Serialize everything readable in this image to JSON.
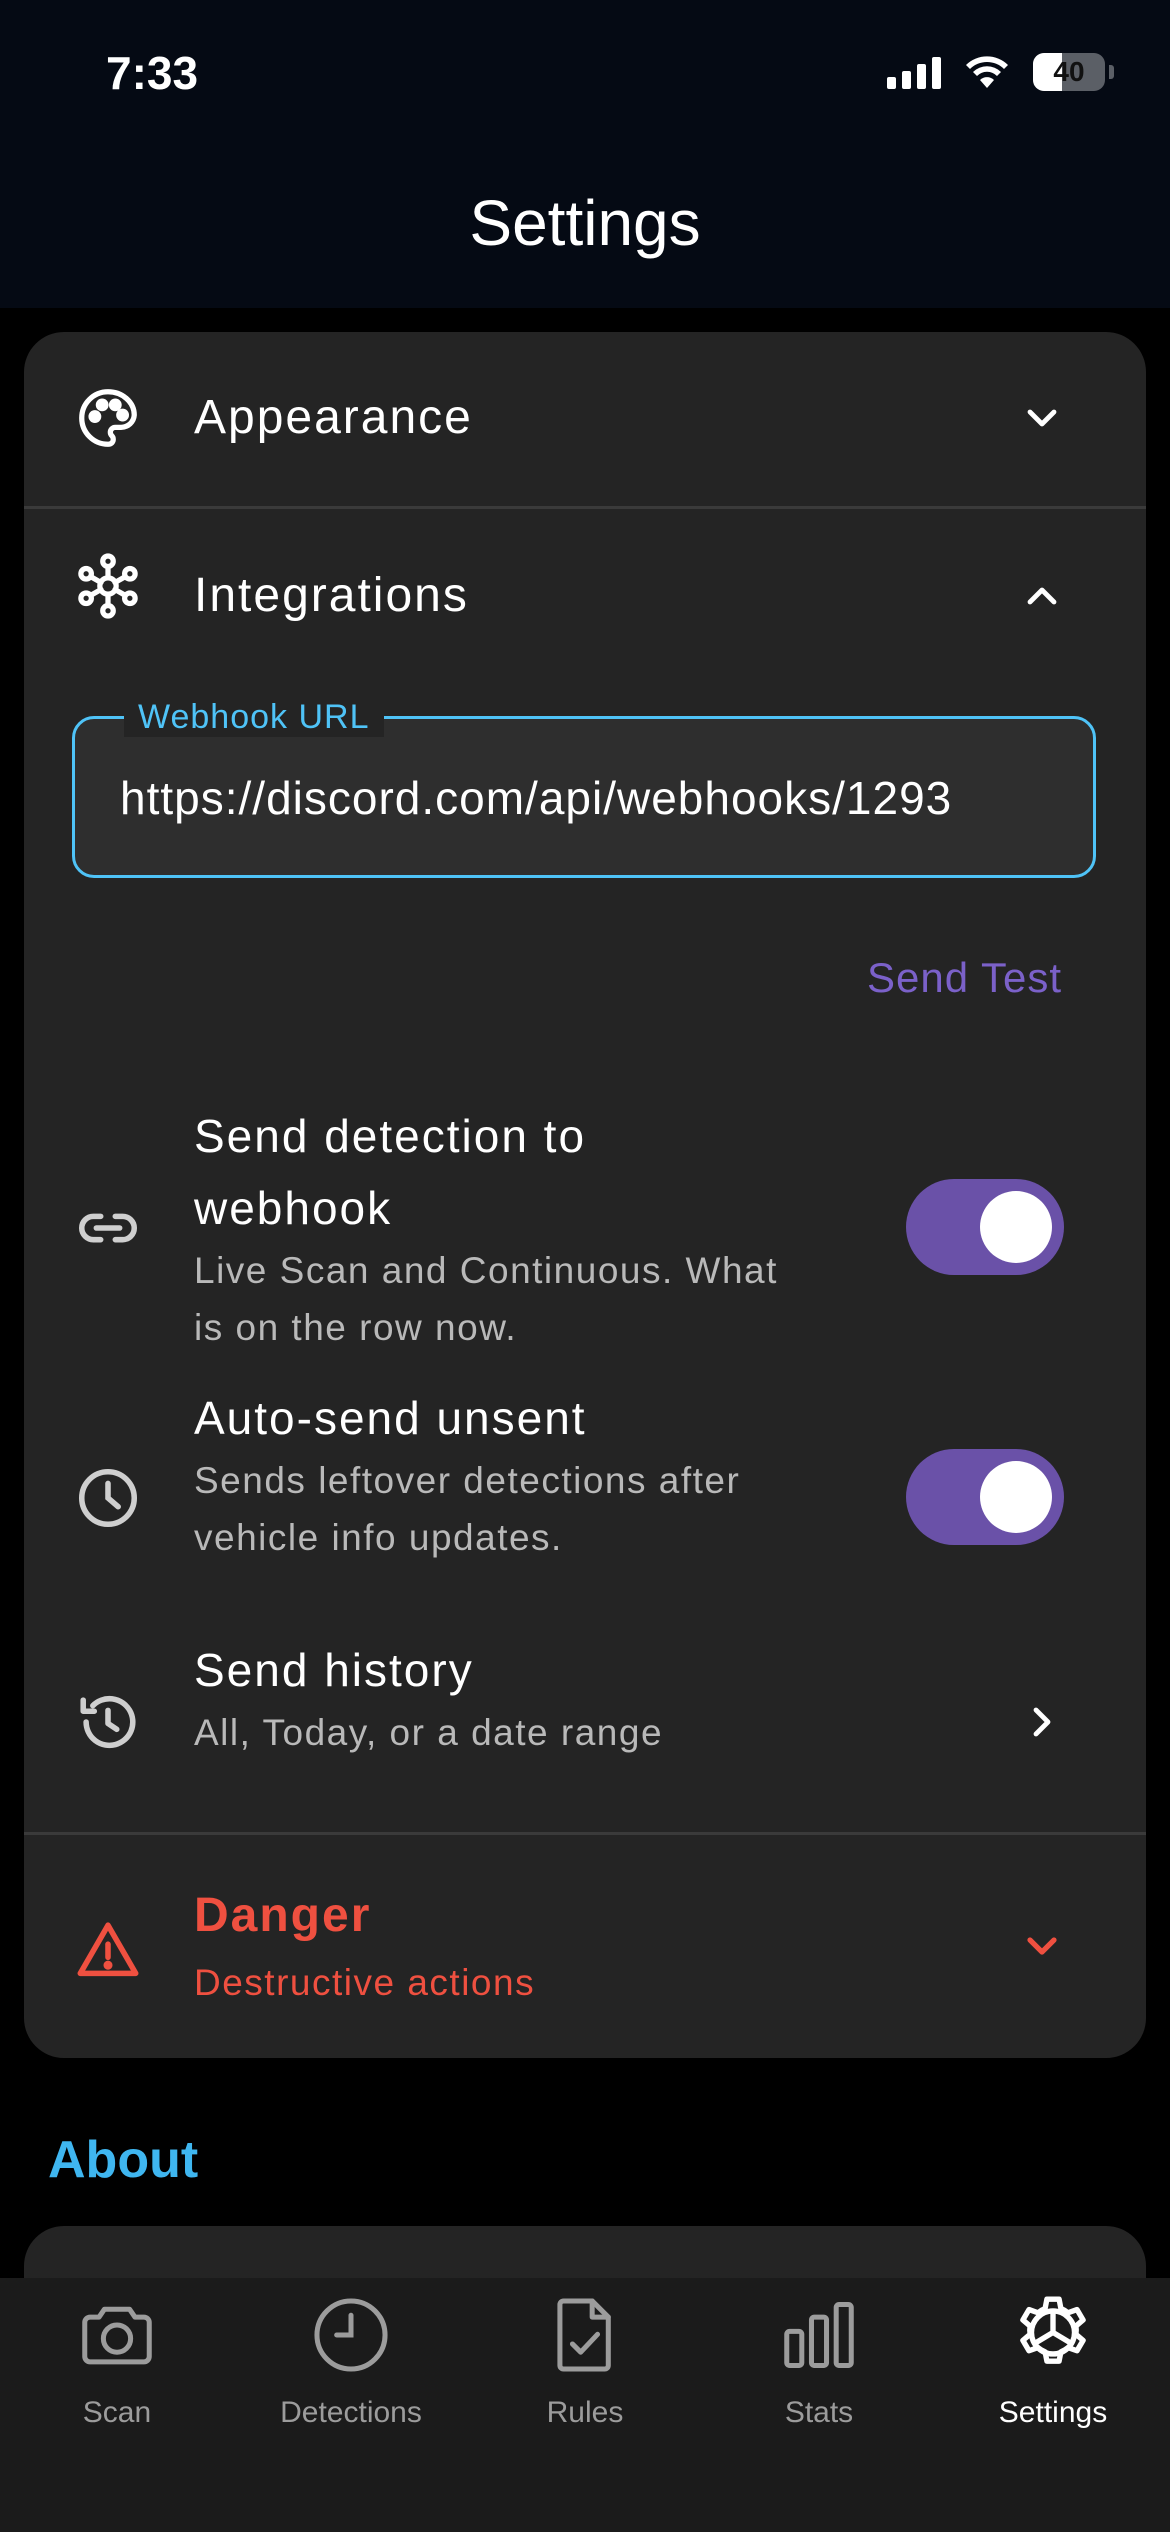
{
  "status_bar": {
    "time": "7:33",
    "battery_percent": 40
  },
  "header": {
    "title": "Settings"
  },
  "sections": {
    "appearance": {
      "title": "Appearance",
      "expanded": false
    },
    "integrations": {
      "title": "Integrations",
      "expanded": true,
      "webhook": {
        "label": "Webhook URL",
        "value": "https://discord.com/api/webhooks/1293",
        "accent": "#4fc3f7"
      },
      "send_test_label": "Send Test",
      "settings": [
        {
          "title_line1": "Send detection to",
          "title_line2": "webhook",
          "sub_line1": "Live Scan and Continuous. What",
          "sub_line2": "is on the row now.",
          "enabled": true
        },
        {
          "title": "Auto-send unsent",
          "sub_line1": "Sends leftover detections after",
          "sub_line2": "vehicle info updates.",
          "enabled": true
        },
        {
          "title": "Send history",
          "sub": "All, Today, or a date range"
        }
      ]
    },
    "danger": {
      "title": "Danger",
      "subtitle": "Destructive actions",
      "color": "#ef5040"
    }
  },
  "about": {
    "title": "About"
  },
  "tabs": [
    {
      "label": "Scan",
      "icon": "camera-icon",
      "active": false
    },
    {
      "label": "Detections",
      "icon": "clock-icon",
      "active": false
    },
    {
      "label": "Rules",
      "icon": "document-check-icon",
      "active": false
    },
    {
      "label": "Stats",
      "icon": "bar-chart-icon",
      "active": false
    },
    {
      "label": "Settings",
      "icon": "gear-icon",
      "active": true
    }
  ],
  "colors": {
    "toggle_on": "#6a51a8",
    "send_test": "#7b61c9",
    "about": "#3fb6f0"
  }
}
